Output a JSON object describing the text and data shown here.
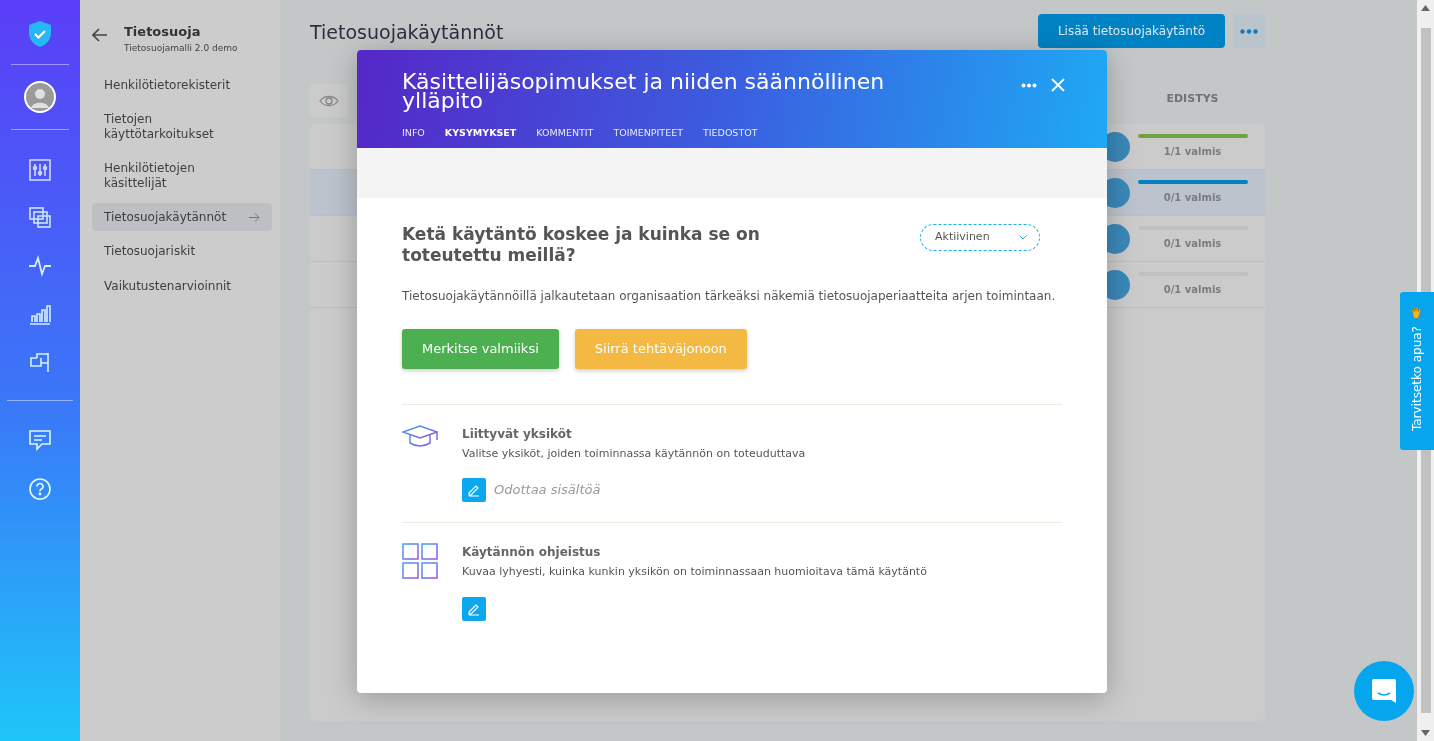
{
  "submenu": {
    "title": "Tietosuoja",
    "subtitle": "Tietosuojamalli 2.0 demo",
    "items": [
      {
        "label": "Henkilötietorekisterit",
        "selected": false
      },
      {
        "label": "Tietojen käyttötarkoitukset",
        "selected": false
      },
      {
        "label": "Henkilötietojen käsittelijät",
        "selected": false
      },
      {
        "label": "Tietosuojakäytännöt",
        "selected": true
      },
      {
        "label": "Tietosuojariskit",
        "selected": false
      },
      {
        "label": "Vaikutustenarvioinnit",
        "selected": false
      }
    ]
  },
  "page": {
    "title": "Tietosuojakäytännöt",
    "add_button": "Lisää tietosuojakäytäntö",
    "table": {
      "columns": [
        "EDISTYS"
      ],
      "rows": [
        {
          "progress": "1/1 valmis",
          "level": 1,
          "selected": false
        },
        {
          "progress": "0/1 valmis",
          "level": 0,
          "selected": true
        },
        {
          "progress": "0/1 valmis",
          "level": 0,
          "selected": false
        },
        {
          "progress": "0/1 valmis",
          "level": 0,
          "selected": false
        }
      ]
    }
  },
  "modal": {
    "title": "Käsittelijäsopimukset ja niiden säännöllinen ylläpito",
    "tabs": [
      {
        "label": "INFO",
        "selected": false
      },
      {
        "label": "KYSYMYKSET",
        "selected": true
      },
      {
        "label": "KOMMENTIT",
        "selected": false
      },
      {
        "label": "TOIMENPITEET",
        "selected": false
      },
      {
        "label": "TIEDOSTOT",
        "selected": false
      }
    ],
    "question": "Ketä käytäntö koskee ja kuinka se on toteutettu meillä?",
    "status": "Aktiivinen",
    "description": "Tietosuojakäytännöillä jalkautetaan organisaation tärkeäksi näkemiä tietosuojaperiaatteita arjen toimintaan.",
    "buttons": [
      {
        "label": "Merkitse valmiiksi",
        "kind": "success"
      },
      {
        "label": "Siirrä tehtäväjonoon",
        "kind": "warning"
      }
    ],
    "sections": [
      {
        "kind": "units",
        "title": "Liittyvät yksiköt",
        "description": "Valitse yksiköt, joiden toiminnassa käytännön on toteuduttava",
        "empty_text": "Odottaa sisältöä"
      },
      {
        "kind": "guide",
        "title": "Käytännön ohjeistus",
        "description": "Kuvaa lyhyesti, kuinka kunkin yksikön on toiminnassaan huomioitava tämä käytäntö"
      }
    ]
  },
  "help_tab": {
    "label": "Tarvitsetko apua?"
  }
}
